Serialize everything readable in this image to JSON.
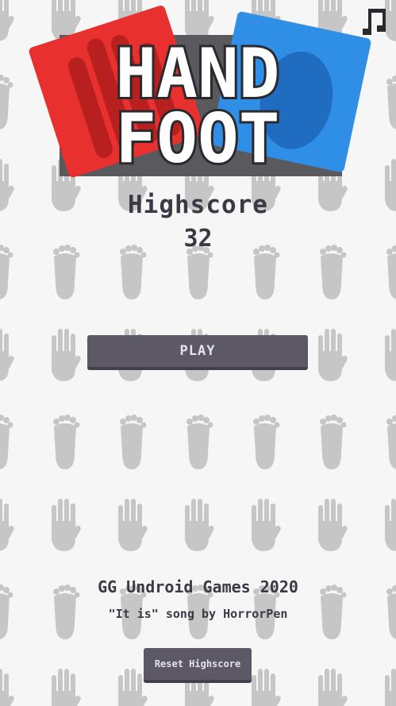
{
  "logo": {
    "line1": "HAND",
    "line2": "FOOT",
    "colors": {
      "hand_card": "#e8302e",
      "foot_card": "#2f8fe6",
      "plate": "#5a5a5e"
    }
  },
  "music_button": {
    "icon": "music-note-icon"
  },
  "highscore": {
    "label": "Highscore",
    "value": "32"
  },
  "play_button": {
    "label": "PLAY"
  },
  "credits": {
    "studio": "GG Undroid Games 2020",
    "song": "\"It is\" song by HorrorPen"
  },
  "reset_button": {
    "label": "Reset Highscore"
  },
  "theme": {
    "background": "#f6f6f6",
    "pattern_gray": "#c4c4c4",
    "button": "#5d5866"
  }
}
